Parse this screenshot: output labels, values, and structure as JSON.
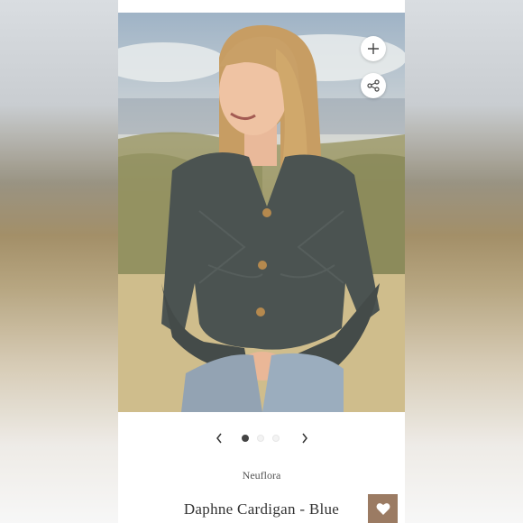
{
  "product": {
    "brand": "Neuflora",
    "title": "Daphne Cardigan - Blue"
  },
  "carousel": {
    "total_images": 3,
    "active_index": 1,
    "prev_icon": "chevron-left-icon",
    "next_icon": "chevron-right-icon"
  },
  "actions": {
    "add_icon": "plus-icon",
    "share_icon": "share-icon",
    "like_icon": "heart-icon"
  },
  "colors": {
    "like_button_bg": "#9b7b63",
    "active_dot": "#444444"
  }
}
